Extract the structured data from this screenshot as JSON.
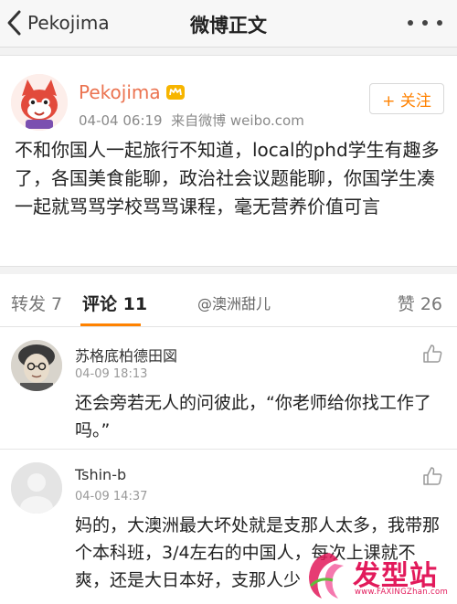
{
  "nav": {
    "back_label": "Pekojima",
    "title": "微博正文"
  },
  "post": {
    "author": "Pekojima",
    "time": "04-04 06:19",
    "source": "来自微博 weibo.com",
    "follow_label": "+ 关注",
    "text": "不和你国人一起旅行不知道，local的phd学生有趣多了，各国美食能聊，政治社会议题能聊，你国学生凑一起就骂骂学校骂骂课程，毫无营养价值可言"
  },
  "tabs": {
    "reposts": "转发 7",
    "comments": "评论 11",
    "watermark": "@澳洲甜儿",
    "likes": "赞 26"
  },
  "comments": [
    {
      "name": "苏格底柏德田図",
      "time": "04-09 18:13",
      "text": "还会旁若无人的问彼此，“你老师给你找工作了吗。”"
    },
    {
      "name": "Tshin-b",
      "time": "04-09 14:37",
      "text": "妈的，大澳洲最大坏处就是支那人太多，我带那个本科班，3/4左右的中国人，每次上课就不爽，还是大日本好，支那人少"
    }
  ],
  "site_watermark": {
    "logo": "发型站",
    "url": "www.FAXINGZhan.com"
  },
  "colors": {
    "accent": "#ff8200",
    "author_name": "#eb7350",
    "watermark": "#e21a5b"
  },
  "icons": [
    "back-chevron-icon",
    "more-dots-icon",
    "vip-crown-icon",
    "thumbs-up-icon"
  ]
}
